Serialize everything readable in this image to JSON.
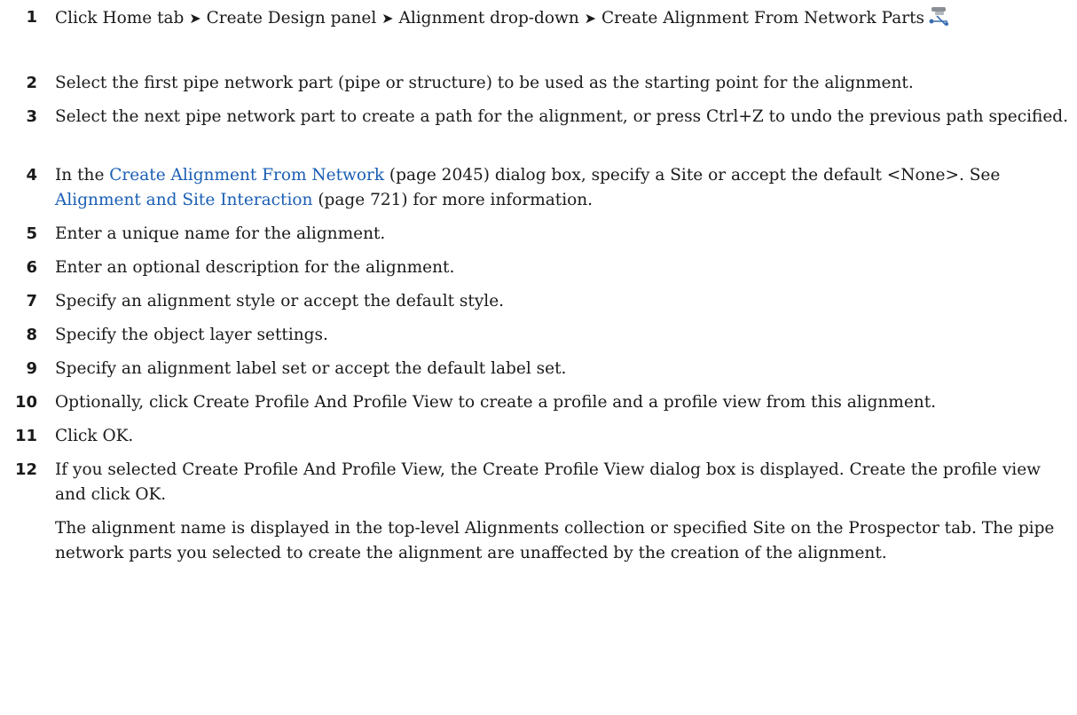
{
  "steps": [
    {
      "num": "1",
      "pre": "Click Home tab ",
      "a1": "➤",
      "mid1": " Create Design panel ",
      "a2": "➤",
      "mid2": " Alignment drop-down ",
      "a3": "➤",
      "post": " Create Alignment From Network Parts",
      "icon": "create-alignment-from-network-parts-icon"
    },
    {
      "num": "2",
      "text": "Select the first pipe network part (pipe or structure) to be used as the starting point for the alignment."
    },
    {
      "num": "3",
      "text": "Select the next pipe network part to create a path for the alignment, or press Ctrl+Z to undo the previous path specified."
    },
    {
      "num": "4",
      "pre": "In the ",
      "link1": "Create Alignment From Network",
      "ref1": " (page 2045) dialog box, specify a Site or accept the default <None>. See ",
      "link2": "Alignment and Site Interaction",
      "ref2": " (page 721) for more information."
    },
    {
      "num": "5",
      "text": "Enter a unique name for the alignment."
    },
    {
      "num": "6",
      "text": "Enter an optional description for the alignment."
    },
    {
      "num": "7",
      "text": "Specify an alignment style or accept the default style."
    },
    {
      "num": "8",
      "text": "Specify the object layer settings."
    },
    {
      "num": "9",
      "text": "Specify an alignment label set or accept the default label set."
    },
    {
      "num": "10",
      "text": "Optionally, click Create Profile And Profile View to create a profile and a profile view from this alignment."
    },
    {
      "num": "11",
      "text": "Click OK."
    },
    {
      "num": "12",
      "text": "If you selected Create Profile And Profile View, the Create Profile View dialog box is displayed. Create the profile view and click OK."
    }
  ],
  "result_paragraph": "The alignment name is displayed in the top-level Alignments collection or specified Site on the Prospector tab. The pipe network parts you selected to create the alignment are unaffected by the creation of the alignment.",
  "colors": {
    "link": "#1a5fb4",
    "text": "#1a1a1a"
  }
}
